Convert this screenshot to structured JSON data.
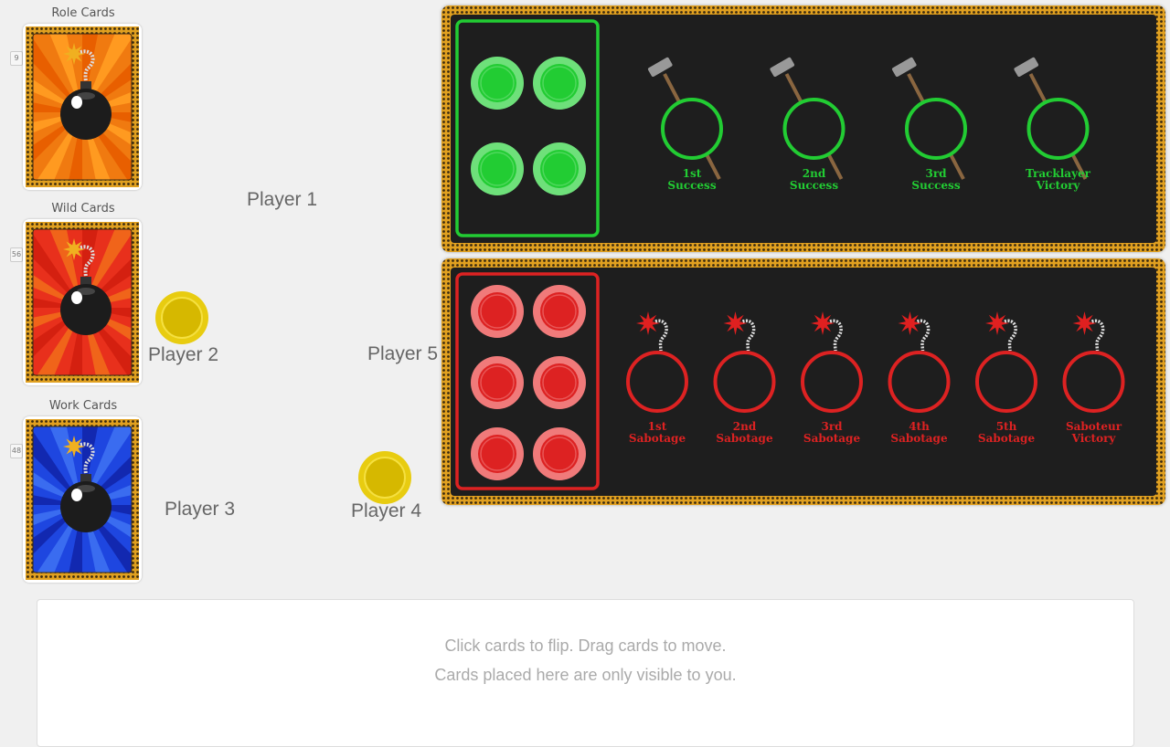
{
  "decks": [
    {
      "label": "Role Cards",
      "count": "9",
      "color": "#f07a10",
      "ray": "#ff9a20",
      "ray2": "#e85f00"
    },
    {
      "label": "Wild Cards",
      "count": "56",
      "color": "#e8301c",
      "ray": "#f0641a",
      "ray2": "#d42010"
    },
    {
      "label": "Work Cards",
      "count": "48",
      "color": "#1e46e0",
      "ray": "#3a6cf0",
      "ray2": "#1228b0"
    }
  ],
  "players": [
    {
      "name": "Player 1"
    },
    {
      "name": "Player 2"
    },
    {
      "name": "Player 3"
    },
    {
      "name": "Player 4"
    },
    {
      "name": "Player 5"
    }
  ],
  "success_board": {
    "color": "#22cc33",
    "token_count": 4,
    "slots": [
      {
        "line1": "1st",
        "line2": "Success"
      },
      {
        "line1": "2nd",
        "line2": "Success"
      },
      {
        "line1": "3rd",
        "line2": "Success"
      },
      {
        "line1": "Tracklayer",
        "line2": "Victory"
      }
    ]
  },
  "sabotage_board": {
    "color": "#dd2222",
    "token_count": 6,
    "slots": [
      {
        "line1": "1st",
        "line2": "Sabotage"
      },
      {
        "line1": "2nd",
        "line2": "Sabotage"
      },
      {
        "line1": "3rd",
        "line2": "Sabotage"
      },
      {
        "line1": "4th",
        "line2": "Sabotage"
      },
      {
        "line1": "5th",
        "line2": "Sabotage"
      },
      {
        "line1": "Saboteur",
        "line2": "Victory"
      }
    ]
  },
  "hand": {
    "line1": "Click cards to flip.   Drag cards to move.",
    "line2": "Cards placed here are only visible to you."
  },
  "icons": {
    "deck_back": "bomb-icon",
    "success_slot": "hammer-icon",
    "sabotage_slot": "bomb-fuse-icon",
    "player_token": "coin-icon"
  }
}
